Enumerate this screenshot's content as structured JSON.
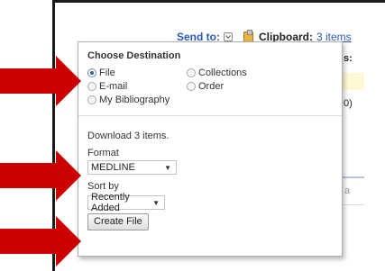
{
  "header": {
    "send_to_label": "Send to:",
    "clipboard_label": "Clipboard:",
    "clipboard_link": "3 items"
  },
  "background_fragments": {
    "frag_s": "s:",
    "frag_0": "0)",
    "frag_a": "a"
  },
  "popup": {
    "title": "Choose Destination",
    "destinations": [
      {
        "label": "File",
        "selected": true
      },
      {
        "label": "Collections",
        "selected": false
      },
      {
        "label": "E-mail",
        "selected": false
      },
      {
        "label": "Order",
        "selected": false
      },
      {
        "label": "My Bibliography",
        "selected": false
      }
    ],
    "download_text": "Download 3 items.",
    "format_label": "Format",
    "format_value": "MEDLINE",
    "sort_label": "Sort by",
    "sort_value": "Recently Added",
    "create_button": "Create File"
  },
  "colors": {
    "annotation_arrow": "#cc0000",
    "link": "#2a59b8",
    "frame": "#1a1a1a"
  },
  "icons": {
    "send_to_dropdown": "chevron-down-icon",
    "clipboard": "clipboard-icon",
    "annotation": "red-arrow-icon"
  }
}
